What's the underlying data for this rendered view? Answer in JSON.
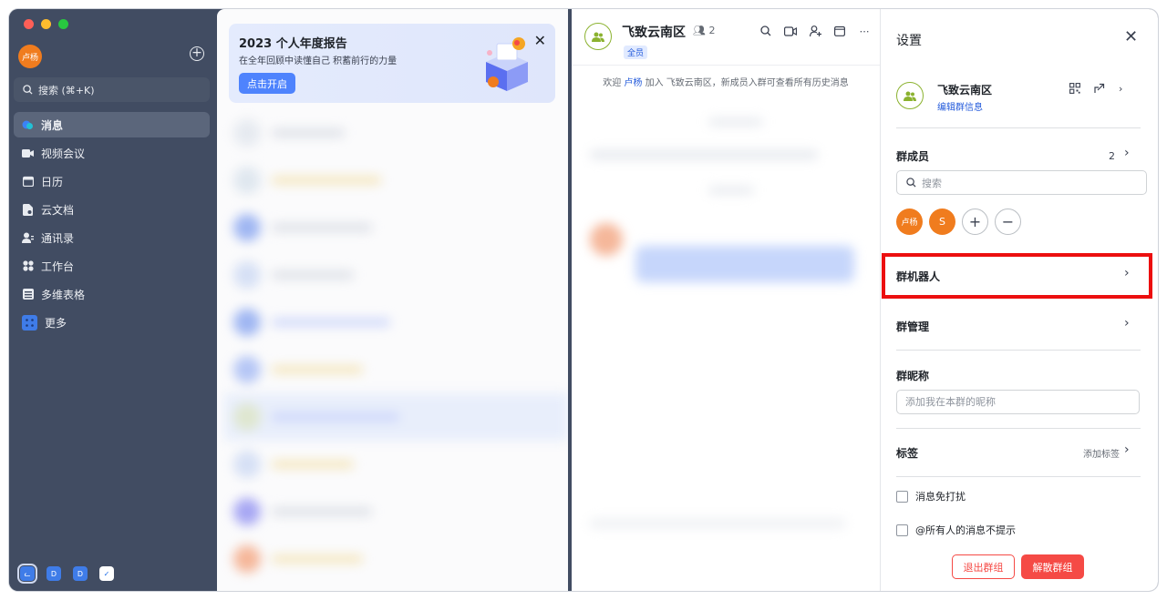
{
  "sidebar": {
    "user_avatar": "卢杨",
    "search_placeholder": "搜索 (⌘+K)",
    "items": [
      {
        "label": "消息",
        "icon": "message-icon"
      },
      {
        "label": "视频会议",
        "icon": "video-icon"
      },
      {
        "label": "日历",
        "icon": "calendar-icon"
      },
      {
        "label": "云文档",
        "icon": "docs-icon"
      },
      {
        "label": "通讯录",
        "icon": "contacts-icon"
      },
      {
        "label": "工作台",
        "icon": "workplace-icon"
      },
      {
        "label": "多维表格",
        "icon": "table-icon"
      },
      {
        "label": "更多",
        "icon": "more-icon"
      }
    ],
    "bottom_apps": [
      "D",
      "D"
    ]
  },
  "report": {
    "title": "2023 个人年度报告",
    "subtitle": "在全年回顾中读懂自己 积蓄前行的力量",
    "button": "点击开启"
  },
  "chat": {
    "title": "飞致云南区",
    "member_count": "2",
    "tag": "全员",
    "system_message_prefix": "欢迎 ",
    "system_message_user": "卢杨",
    "system_message_suffix": " 加入 飞致云南区，新成员入群可查看所有历史消息"
  },
  "settings": {
    "title": "设置",
    "group_name": "飞致云南区",
    "edit_group": "编辑群信息",
    "members_label": "群成员",
    "members_count": "2",
    "search_placeholder": "搜索",
    "members": [
      "卢杨",
      "S"
    ],
    "bots_label": "群机器人",
    "manage_label": "群管理",
    "nickname_label": "群昵称",
    "nickname_placeholder": "添加我在本群的昵称",
    "tags_label": "标签",
    "add_tag": "添加标签",
    "mute_label": "消息免打扰",
    "at_all_label": "@所有人的消息不提示",
    "leave_button": "退出群组",
    "dissolve_button": "解散群组"
  },
  "colors": {
    "sidebar": "#414c62",
    "accent": "#4e83fd",
    "danger": "#f54a45",
    "highlight_box": "#ec0f0f"
  }
}
